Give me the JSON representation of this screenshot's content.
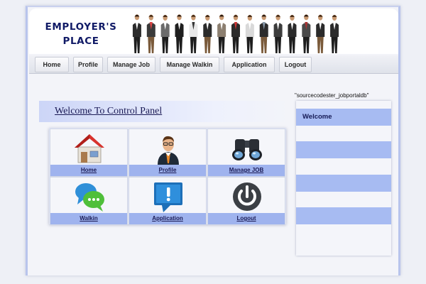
{
  "header": {
    "logo_line1": "EMPLOYER'S",
    "logo_line2": "PLACE"
  },
  "nav": {
    "items": [
      {
        "label": "Home"
      },
      {
        "label": "Profile"
      },
      {
        "label": "Manage Job"
      },
      {
        "label": "Manage Walkin"
      },
      {
        "label": "Application"
      },
      {
        "label": "Logout"
      }
    ]
  },
  "db_name": "\"sourcecodester_jobportaldb\"",
  "main": {
    "welcome_title": "Welcome To Control Panel",
    "tiles": [
      {
        "label": "Home",
        "icon": "house-icon"
      },
      {
        "label": "Profile",
        "icon": "businessman-icon"
      },
      {
        "label": "Manage JOB",
        "icon": "binoculars-icon"
      },
      {
        "label": "Walkin",
        "icon": "chat-bubbles-icon"
      },
      {
        "label": "Application",
        "icon": "alert-message-icon"
      },
      {
        "label": "Logout",
        "icon": "power-icon"
      }
    ]
  },
  "sidebar": {
    "title": "Welcome"
  },
  "colors": {
    "accent_blue": "#a7bbf2",
    "nav_text": "#2a2a2a",
    "logo_text": "#101a66"
  }
}
